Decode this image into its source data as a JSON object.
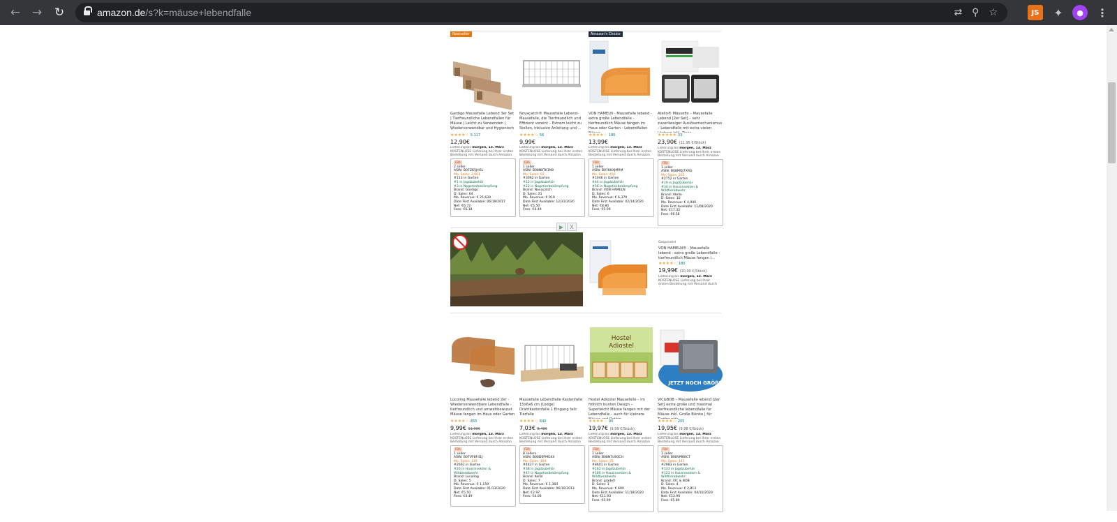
{
  "browser": {
    "url_host": "amazon.de",
    "url_path": "/s?k=mäuse+lebendfalle",
    "ext_js": "JS"
  },
  "colors": {
    "chrome": "#35363a",
    "omnibox": "#202124",
    "rating": "#f3a847",
    "link": "#007185",
    "badge_best": "#e47911",
    "badge_choice": "#232f3e"
  },
  "row1": [
    {
      "badge": "Bestseller",
      "title": "Gardigo Mausefalle Lebend 3er Set | Tierfreundliche Lebendfallen für Mäuse | Leicht zu Verwenden | Wiederverwendbar und Hygienisch",
      "stars": "★★★★☆",
      "reviews": "5.117",
      "price": "12,90€",
      "unit": "",
      "strike": "",
      "delivery_line": "Lieferung bis",
      "delivery_date": "morgen, 13. März",
      "delivery_note": "KOSTENLOSE Lieferung bei Ihrer ersten Bestellung mit Versand durch Amazon",
      "stats": [
        "2 seller",
        "ASIN: B07ZK5JH6L",
        "Mo. Sales: 2,661",
        "#113 in Garten",
        "#1 in Jagdzubehör",
        "#3 in Nagetierbekämpfung",
        "Brand: Gardigo",
        "D. Sales: 64",
        "Mo. Revenue: € 25,639",
        "Date First Available: 06/19/2017",
        "Net: €6.72",
        "Fees: €6.18"
      ]
    },
    {
      "badge": "",
      "title": "Novacatch® Mausefalle Lebend- Mausefalle, die Tierfreundlich und Effizient vereint – Extrem leicht zu Stellen, inklusive Anleitung und ...",
      "stars": "★★★★☆",
      "reviews": "56",
      "price": "9,99€",
      "unit": "",
      "strike": "",
      "delivery_line": "Lieferung bis",
      "delivery_date": "morgen, 13. März",
      "delivery_note": "KOSTENLOSE Lieferung bei Ihrer ersten Bestellung mit Versand durch Amazon",
      "stats": [
        "1 seller",
        "ASIN: B08NKTK1N9",
        "Mo. Sales: 92",
        "#3062 in Garten",
        "#12 in Jagdzubehör",
        "#22 in Nagetierbekämpfung",
        "Brand: Novacatch",
        "D. Sales: 21",
        "Mo. Revenue: € 919",
        "Date First Available: 12/31/2020",
        "Net: €5.50",
        "Fees: €4.49"
      ]
    },
    {
      "badge": "Amazon's Choice",
      "title": "VON HAMELN - Mausefalle lebend - extra große Lebendfalle - tierfreundlich Mäuse fangen im Haus oder Garten - Lebendfallen Mäuse ...",
      "stars": "★★★★☆",
      "reviews": "180",
      "price": "13,99€",
      "unit": "",
      "strike": "",
      "delivery_line": "Lieferung bis",
      "delivery_date": "morgen, 13. März",
      "delivery_note": "KOSTENLOSE Lieferung bei Ihrer ersten Bestellung mit Versand durch Amazon",
      "stats": [
        "1 seller",
        "ASIN: B07KKXJMRM",
        "Mo. Sales: 456",
        "#1046 in Garten",
        "#44 in Jagdzubehör",
        "#56 in Nagetierbekämpfung",
        "Brand: VON HAMELN",
        "D. Sales: 6",
        "Mo. Revenue: € 6,379",
        "Date First Available: 02/14/2020",
        "Net: €8.80",
        "Fees: €5.09"
      ]
    },
    {
      "badge": "",
      "title": "Atello® Mäusefix – Mausefalle Lebend [2er Set] – sehr zuverlässiger Auslösemechanismus – Lebendfalle mit extra vielen Löchern inkl. Tipps ...",
      "stars": "★★★★★",
      "reviews": "33",
      "price": "23,90€",
      "unit": "(11,95 €/Stück)",
      "strike": "",
      "delivery_line": "Lieferung bis",
      "delivery_date": "morgen, 13. März",
      "delivery_note": "KOSTENLOSE Lieferung bei Ihrer ersten Bestellung mit Versand durch Amazon",
      "stats": [
        "1 seller",
        "ASIN: B08MQJ7XRG",
        "Mo. Sales: 205",
        "#2752 in Garten",
        "#19 in Jagdzubehör",
        "#34 in Hausinsekten & Wildtierabwehr",
        "Brand: Atello",
        "D. Sales: 10",
        "Mo. Revenue: € 4,900",
        "Date First Available: 11/08/2020",
        "Net: €17.32",
        "Fees: €6.58"
      ]
    }
  ],
  "sponsored": {
    "label": "Gesponsert",
    "title": "VON HAMELN® - Mausefalle lebend - extra große Lebendfalle - tierfreundlich Mäuse fangen i...",
    "stars": "★★★★☆",
    "reviews": "180",
    "price": "19,99€",
    "unit": "(10,00 €/Stück)",
    "delivery_line": "Lieferung bis",
    "delivery_date": "morgen, 13. März",
    "delivery_note": "KOSTENLOSE Lieferung bei Ihrer ersten Bestellung mit Versand durch Amazon",
    "play": "▶",
    "close": "X"
  },
  "row3": [
    {
      "title": "Lucoling Mausefalle lebend 2er - Wiederverwendbare Lebendfalle - tierfreundlich und umweltbewusst Mäuse fangen im Haus oder Garten ...",
      "stars": "★★★★☆",
      "reviews": "855",
      "price": "9,99€",
      "unit": "",
      "strike": "11,99€",
      "delivery_line": "Lieferung bis",
      "delivery_date": "morgen, 13. März",
      "delivery_note": "KOSTENLOSE Lieferung bei Ihrer ersten Bestellung mit Versand durch Amazon",
      "stats": [
        "1 seller",
        "ASIN: B07VF8F41J",
        "Mo. Sales: 116",
        "#2661 in Garten",
        "#26 in Hausinsekten & Wildtierabwehr",
        "Brand: Lucoling",
        "D. Sales: 5",
        "Mo. Revenue: € 1,159",
        "Date First Available: 01/13/2020",
        "Net: €5.50",
        "Fees: €4.49"
      ]
    },
    {
      "title": "Mausefalle Lebendfalle Kastenfalle 15x6x6 cm (Lodge) Drahtkastenfalle 1 Eingang fallr Tierfalle",
      "stars": "★★★★☆",
      "reviews": "640",
      "price": "7,03€",
      "unit": "",
      "strike": "8,49€",
      "delivery_line": "Lieferung bis",
      "delivery_date": "morgen, 13. März",
      "delivery_note": "KOSTENLOSE Lieferung bei Ihrer ersten Bestellung mit Versand durch Amazon",
      "stats": [
        "8 sellers",
        "ASIN: B00DSPMG44",
        "Mo. Sales: 184",
        "#4427 in Garten",
        "#38 in Jagdzubehör",
        "#47 in Nagetierbekämpfung",
        "Brand: Kerbl",
        "D. Sales: 7",
        "Mo. Revenue: € 1,364",
        "Date First Available: 06/10/2013",
        "Net: €2.97",
        "Fees: €4.06"
      ]
    },
    {
      "title": "Hostel Adiostel Mausefalle – im fröhlich bunten Design – Superleicht Mäuse fangen mit der Lebendfalle – auch für kleinere Mäuse und Ratten...",
      "stars": "★★★★☆",
      "reviews": "90",
      "price": "19,97€",
      "unit": "(9,99 €/Stück)",
      "strike": "",
      "delivery_line": "Lieferung bis",
      "delivery_date": "morgen, 13. März",
      "delivery_note": "KOSTENLOSE Lieferung bei Ihrer ersten Bestellung mit Versand durch Amazon",
      "stats": [
        "1 seller",
        "ASIN: B08N7L9QCH",
        "Mo. Sales: 35",
        "#8601 in Garten",
        "#162 in Jagdzubehör",
        "#186 in Hausinsekten & Wildtierabwehr",
        "Brand: gradeV",
        "D. Sales: 1",
        "Mo. Revenue: € 699",
        "Date First Available: 11/18/2020",
        "Net: €11.93",
        "Fees: €5.99"
      ]
    },
    {
      "title": "VIC&BOB – Mausefalle lebend [2er Set] extra große und maximal tierfreundliche lebendfalle für Mäuse inkl. Große Bürste | für Tierfreunde...",
      "stars": "★★★★☆",
      "reviews": "205",
      "price": "19,95€",
      "unit": "(9,98 €/Stück)",
      "strike": "",
      "delivery_line": "Lieferung bis",
      "delivery_date": "morgen, 13. März",
      "delivery_note": "KOSTENLOSE Lieferung bei Ihrer ersten Bestellung mit Versand durch Amazon",
      "stats": [
        "1 seller",
        "ASIN: B08VMRKCT",
        "Mo. Sales: 141",
        "#2983 in Garten",
        "#133 in Jagdzubehör",
        "#123 in Hausinsekten & Wildtierabwehr",
        "Brand: VIC & BOB",
        "D. Sales: 4",
        "Mo. Revenue: € 2,813",
        "Date First Available: 04/10/2020",
        "Net: €13.90",
        "Fees: €5.89"
      ]
    }
  ]
}
